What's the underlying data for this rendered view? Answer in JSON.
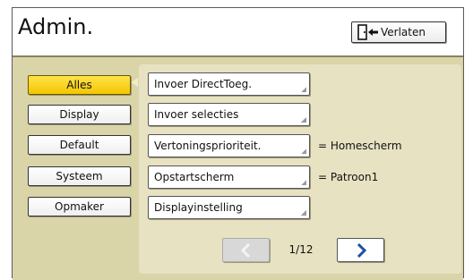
{
  "header": {
    "title": "Admin.",
    "exit_label": "Verlaten",
    "exit_icon": "exit-door-icon"
  },
  "categories": [
    {
      "label": "Alles",
      "active": true
    },
    {
      "label": "Display",
      "active": false
    },
    {
      "label": "Default",
      "active": false
    },
    {
      "label": "Systeem",
      "active": false
    },
    {
      "label": "Opmaker",
      "active": false
    }
  ],
  "settings": [
    {
      "label": "Invoer DirectToeg.",
      "value": ""
    },
    {
      "label": "Invoer selecties",
      "value": ""
    },
    {
      "label": "Vertoningsprioriteit.",
      "value": "= Homescherm"
    },
    {
      "label": "Opstartscherm",
      "value": "= Patroon1"
    },
    {
      "label": "Displayinstelling",
      "value": ""
    }
  ],
  "pagination": {
    "indicator": "1/12",
    "prev_icon": "chevron-left-icon",
    "next_icon": "chevron-right-icon",
    "prev_enabled": false
  },
  "colors": {
    "active_category": "#f2c600",
    "panel": "#dad4a9",
    "next_arrow": "#1e4fa8"
  }
}
